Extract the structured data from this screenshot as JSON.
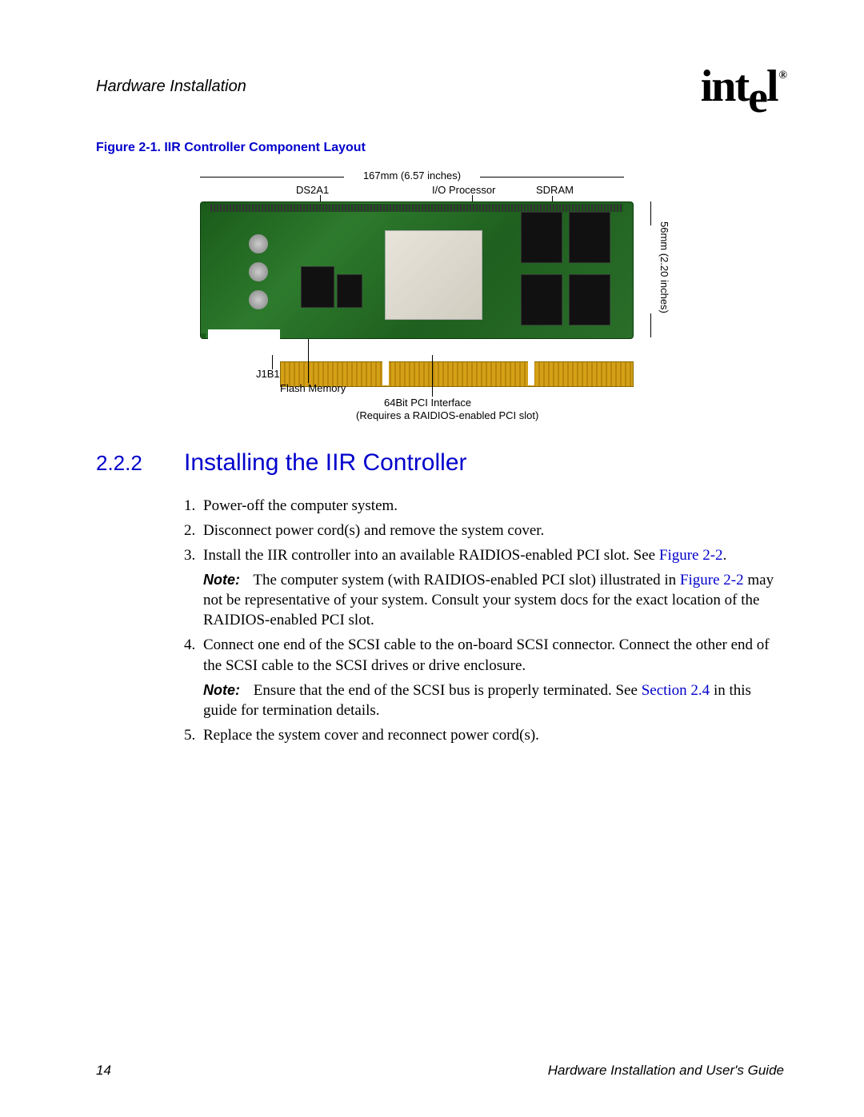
{
  "header": {
    "section": "Hardware Installation",
    "logo_text_1": "int",
    "logo_text_e": "e",
    "logo_text_2": "l",
    "logo_r": "®"
  },
  "figure": {
    "caption": "Figure 2-1. IIR Controller Component Layout",
    "dim_width": "167mm (6.57 inches)",
    "dim_height": "56mm (2.20 inches)",
    "labels": {
      "ds2a1": "DS2A1",
      "io_processor": "I/O Processor",
      "sdram": "SDRAM",
      "j1b1": "J1B1",
      "flash": "Flash Memory",
      "pci_line1": "64Bit PCI Interface",
      "pci_line2": "(Requires a RAIDIOS-enabled PCI slot)"
    }
  },
  "section": {
    "number": "2.2.2",
    "title": "Installing the IIR Controller"
  },
  "steps": {
    "s1_num": "1.",
    "s1": "Power-off the computer system.",
    "s2_num": "2.",
    "s2": "Disconnect power cord(s) and remove the system cover.",
    "s3_num": "3.",
    "s3a": "Install the IIR controller into an available RAIDIOS-enabled PCI slot. See ",
    "s3_link": "Figure 2-2",
    "s3b": ".",
    "note1_label": "Note:",
    "note1a": "The computer system (with RAIDIOS-enabled PCI slot) illustrated in ",
    "note1_link": "Figure 2-2",
    "note1b": " may not be representative of your system. Consult your system docs for the exact location of the RAIDIOS-enabled PCI slot.",
    "s4_num": "4.",
    "s4": "Connect one end of the SCSI cable to the on-board SCSI connector. Connect the other end of the SCSI cable to the SCSI drives or drive enclosure.",
    "note2_label": "Note:",
    "note2a": "Ensure that the end of the SCSI bus is properly terminated. See ",
    "note2_link": "Section 2.4",
    "note2b": " in this guide for termination details.",
    "s5_num": "5.",
    "s5": "Replace the system cover and reconnect power cord(s)."
  },
  "footer": {
    "page": "14",
    "doc": "Hardware Installation and User's Guide"
  }
}
